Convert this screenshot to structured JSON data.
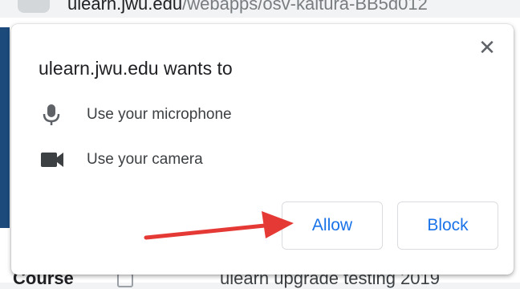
{
  "browser": {
    "url_host": "ulearn.jwu.edu",
    "url_path": "/webapps/osv-kaltura-BB5d012"
  },
  "background": {
    "left_text": "Course",
    "right_text": "ulearn upgrade testing 2019"
  },
  "dialog": {
    "title": "ulearn.jwu.edu wants to",
    "permissions": [
      {
        "icon": "microphone-icon",
        "label": "Use your microphone"
      },
      {
        "icon": "camera-icon",
        "label": "Use your camera"
      }
    ],
    "close_symbol": "✕",
    "allow_label": "Allow",
    "block_label": "Block"
  },
  "colors": {
    "accent": "#1a73e8",
    "annotation_arrow": "#e53935"
  }
}
